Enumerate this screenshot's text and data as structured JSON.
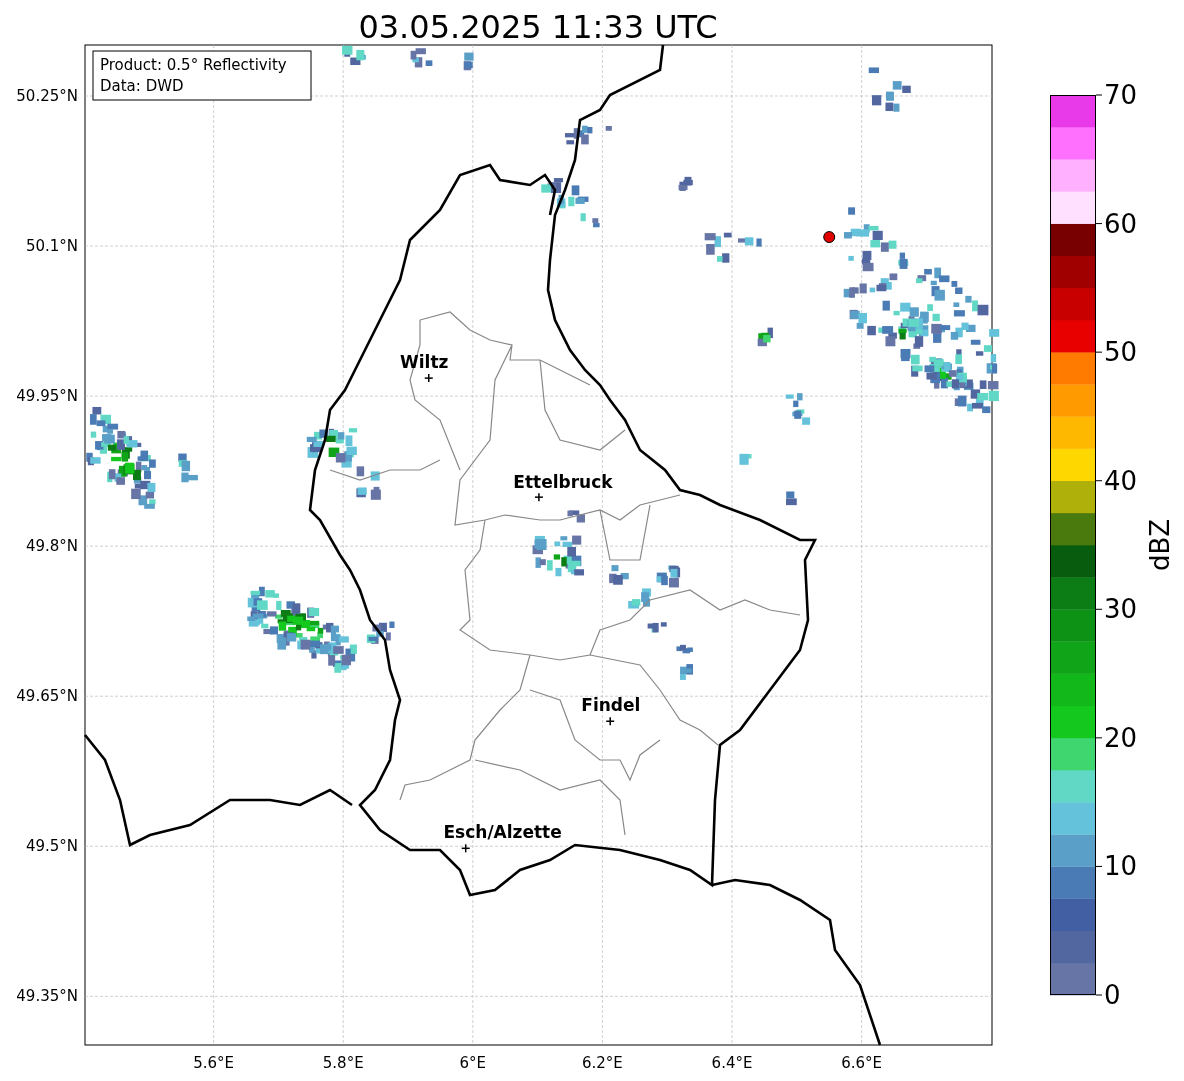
{
  "title": "03.05.2025 11:33 UTC",
  "info_box": [
    "Product: 0.5° Reflectivity",
    "Data: DWD"
  ],
  "map": {
    "xticks": [
      "5.6°E",
      "5.8°E",
      "6°E",
      "6.2°E",
      "6.4°E",
      "6.6°E"
    ],
    "yticks": [
      "50.25°N",
      "50.1°N",
      "49.95°N",
      "49.8°N",
      "49.65°N",
      "49.5°N",
      "49.35°N"
    ],
    "cities": [
      "Wiltz",
      "Ettelbruck",
      "Findel",
      "Esch/Alzette"
    ]
  },
  "colorbar": {
    "label": "dBZ",
    "ticks": [
      "70",
      "60",
      "50",
      "40",
      "30",
      "20",
      "10",
      "0"
    ]
  }
}
